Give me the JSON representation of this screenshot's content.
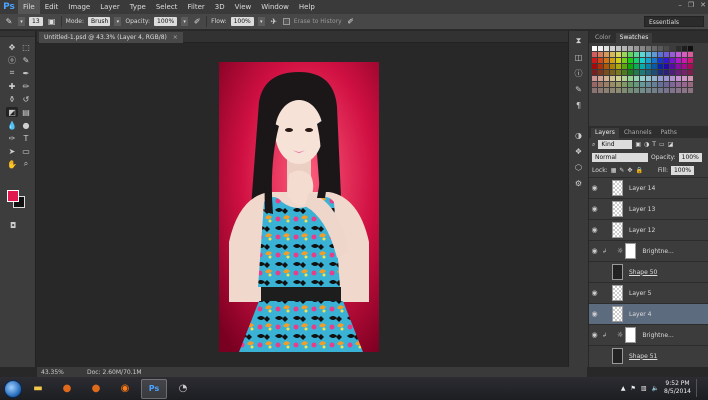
{
  "app": {
    "logo": "Ps",
    "menus": [
      "File",
      "Edit",
      "Image",
      "Layer",
      "Type",
      "Select",
      "Filter",
      "3D",
      "View",
      "Window",
      "Help"
    ],
    "window_controls": [
      "–",
      "❐",
      "✕"
    ]
  },
  "options": {
    "mode_label": "Mode:",
    "mode_value": "Brush",
    "opacity_label": "Opacity:",
    "opacity_value": "100%",
    "flow_label": "Flow:",
    "flow_value": "100%",
    "erase_history": "Erase to History",
    "workspace": "Essentials",
    "brush_size": "13"
  },
  "document": {
    "tab_title": "Untitled-1.psd @ 43.3% (Layer 4, RGB/8)",
    "tab_close": "×",
    "zoom": "43.35%",
    "doc_info": "Doc: 2.60M/70.1M"
  },
  "tools": {
    "foreground": "#e0184e",
    "background": "#111111"
  },
  "swatch_panel": {
    "tabs": [
      "Color",
      "Swatches"
    ],
    "active_tab": "Swatches"
  },
  "layers_panel": {
    "tabs": [
      "Layers",
      "Channels",
      "Paths"
    ],
    "active_tab": "Layers",
    "kind_label": "Kind",
    "blend_mode": "Normal",
    "opacity_label": "Opacity:",
    "opacity_value": "100%",
    "lock_label": "Lock:",
    "fill_label": "Fill:",
    "fill_value": "100%",
    "layers": [
      {
        "name": "Layer 14",
        "type": "pixel",
        "visible": true,
        "selected": false
      },
      {
        "name": "Layer 13",
        "type": "pixel",
        "visible": true,
        "selected": false
      },
      {
        "name": "Layer 12",
        "type": "pixel",
        "visible": true,
        "selected": false
      },
      {
        "name": "Brightne...",
        "type": "adjustment",
        "visible": true,
        "selected": false
      },
      {
        "name": "Shape 50",
        "type": "shape",
        "visible": false,
        "selected": false
      },
      {
        "name": "Layer 5",
        "type": "pixel",
        "visible": true,
        "selected": false
      },
      {
        "name": "Layer 4",
        "type": "pixel",
        "visible": true,
        "selected": true
      },
      {
        "name": "Brightne...",
        "type": "adjustment",
        "visible": true,
        "selected": false
      },
      {
        "name": "Shape 51",
        "type": "shape",
        "visible": false,
        "selected": false
      }
    ]
  },
  "taskbar": {
    "time": "9:52 PM",
    "date": "8/5/2014"
  }
}
